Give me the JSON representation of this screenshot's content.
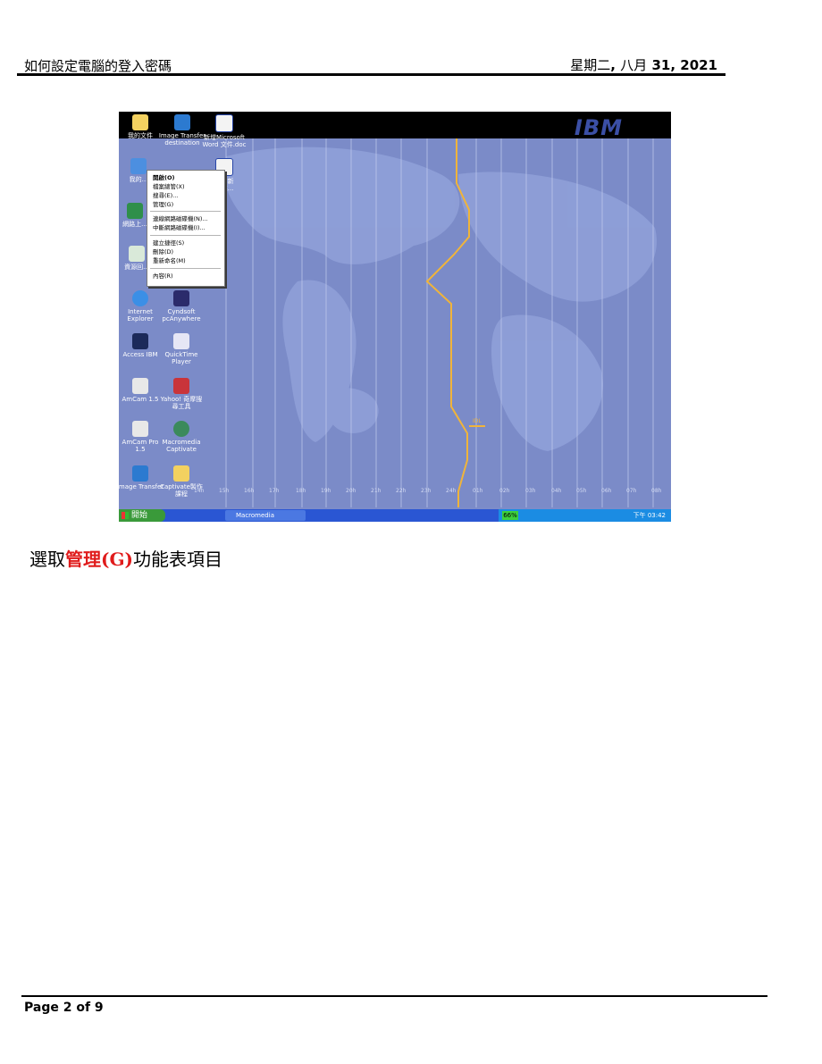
{
  "header": {
    "doc_title": "如何設定電腦的登入密碼",
    "date_prefix": "星期二",
    "date_sep": ", ",
    "date_month": "八月",
    "date_day_year": " 31, 2021"
  },
  "screenshot": {
    "brand_logo": "IBM",
    "desktop_icons": [
      {
        "label": "我的文件",
        "icon": "folder-documents-icon"
      },
      {
        "label": "Image Transfer",
        "icon": "image-transfer-icon",
        "label2": "destination"
      },
      {
        "label": "新增Microsoft",
        "icon": "word-document-icon",
        "label2": "Word 文件.doc"
      },
      {
        "label": "我的...",
        "icon": "computer-icon"
      },
      {
        "label": "網路上...",
        "icon": "network-icon"
      },
      {
        "label": "資源回...",
        "icon": "recycle-bin-icon"
      },
      {
        "label": "Internet",
        "icon": "internet-explorer-icon",
        "label2": "Explorer"
      },
      {
        "label": "Cyndsoft",
        "icon": "cyndsoft-icon",
        "label2": "pcAnywhere"
      },
      {
        "label": "Access IBM",
        "icon": "access-ibm-icon"
      },
      {
        "label": "QuickTime",
        "icon": "quicktime-icon",
        "label2": "Player"
      },
      {
        "label": "AmCam 1.5",
        "icon": "amcam-icon"
      },
      {
        "label": "Yahoo! 奇摩搜",
        "icon": "yahoo-icon",
        "label2": "尋工具"
      },
      {
        "label": "AmCam Pro",
        "icon": "amcam-pro-icon",
        "label2": "1.5"
      },
      {
        "label": "Macromedia",
        "icon": "captivate-icon",
        "label2": "Captivate"
      },
      {
        "label": "Image Transfer",
        "icon": "image-transfer-icon-2"
      },
      {
        "label": "Captivate製作",
        "icon": "folder-icon",
        "label2": "課程"
      },
      {
        "label": "最多新",
        "icon": "word-document-icon-2",
        "label2": "作業..."
      }
    ],
    "context_menu": [
      {
        "label": "開啟(O)",
        "bold": true
      },
      {
        "label": "檔案總管(X)"
      },
      {
        "label": "搜尋(E)..."
      },
      {
        "label": "管理(G)"
      },
      {
        "label": "連線網路磁碟機(N)..."
      },
      {
        "label": "中斷網路磁碟機(I)..."
      },
      {
        "label": "建立捷徑(S)"
      },
      {
        "label": "刪除(D)"
      },
      {
        "label": "重新命名(M)"
      },
      {
        "label": "內容(R)"
      }
    ],
    "idl_label": "IDL",
    "hours": [
      "14h",
      "15h",
      "16h",
      "17h",
      "18h",
      "19h",
      "20h",
      "21h",
      "22h",
      "23h",
      "24h",
      "01h",
      "02h",
      "03h",
      "04h",
      "05h",
      "06h",
      "07h",
      "08h"
    ],
    "taskbar": {
      "start_label": "開始",
      "task_label": "Macromedia Captivate",
      "battery": "66%",
      "clock": "下午 03:42"
    }
  },
  "caption": {
    "prefix": "選取",
    "highlight": "管理",
    "highlight2": "(G)",
    "suffix": "功能表項目"
  },
  "footer": {
    "page_label": "Page 2 of 9"
  }
}
